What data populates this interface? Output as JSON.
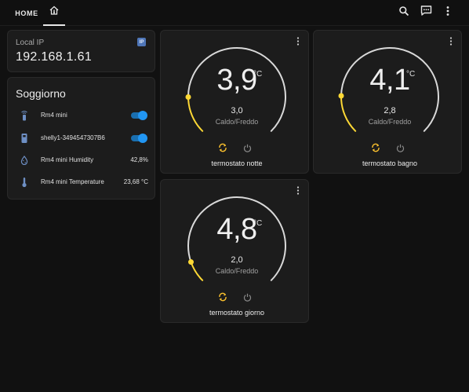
{
  "header": {
    "tabs": [
      {
        "label": "HOME",
        "active": false
      },
      {
        "icon": "home-thermometer-icon",
        "active": true
      }
    ],
    "actions": [
      "search-icon",
      "assist-icon",
      "more-vertical-icon"
    ]
  },
  "ip_card": {
    "label": "Local IP",
    "value": "192.168.1.61",
    "badge": "IP"
  },
  "entities_card": {
    "title": "Soggiorno",
    "rows": [
      {
        "icon": "remote-icon",
        "name": "Rm4 mini",
        "type": "toggle",
        "on": true
      },
      {
        "icon": "smart-plug-icon",
        "name": "shelly1-3494547307B6",
        "type": "toggle",
        "on": true
      },
      {
        "icon": "water-percent-icon",
        "name": "Rm4 mini Humidity",
        "type": "value",
        "state": "42,8%"
      },
      {
        "icon": "thermometer-icon",
        "name": "Rm4 mini Temperature",
        "type": "value",
        "state": "23,68 °C"
      }
    ]
  },
  "thermostats": [
    {
      "name": "termostato notte",
      "current": "3,9",
      "unit": "°C",
      "target": "3,0",
      "mode": "Caldo/Freddo",
      "level": 0.07
    },
    {
      "name": "termostato bagno",
      "current": "4,1",
      "unit": "°C",
      "target": "2,8",
      "mode": "Caldo/Freddo",
      "level": 0.06
    },
    {
      "name": "termostato giorno",
      "current": "4,8",
      "unit": "°C",
      "target": "2,0",
      "mode": "Caldo/Freddo",
      "level": 0.01
    }
  ],
  "colors": {
    "background": "#111111",
    "card": "#1c1c1c",
    "accent": "#2196f3",
    "heat_arc": "#fdd835",
    "track": "#d9d9d9"
  }
}
